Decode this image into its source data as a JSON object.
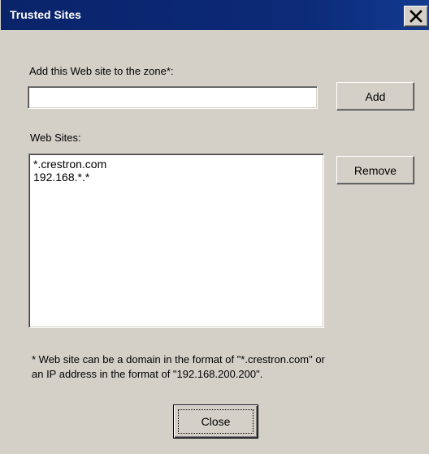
{
  "dialog": {
    "title": "Trusted Sites",
    "close_icon": "close-x-icon"
  },
  "add_section": {
    "label": "Add this Web site to the zone*:",
    "input_value": "",
    "add_button": "Add"
  },
  "websites": {
    "label": "Web Sites:",
    "items": [
      "*.crestron.com",
      "192.168.*.*"
    ],
    "remove_button": "Remove"
  },
  "footnote": {
    "line1": "* Web site can be a domain in the format of \"*.crestron.com\" or",
    "line2": "an IP address in the format of \"192.168.200.200\"."
  },
  "close_button": "Close"
}
